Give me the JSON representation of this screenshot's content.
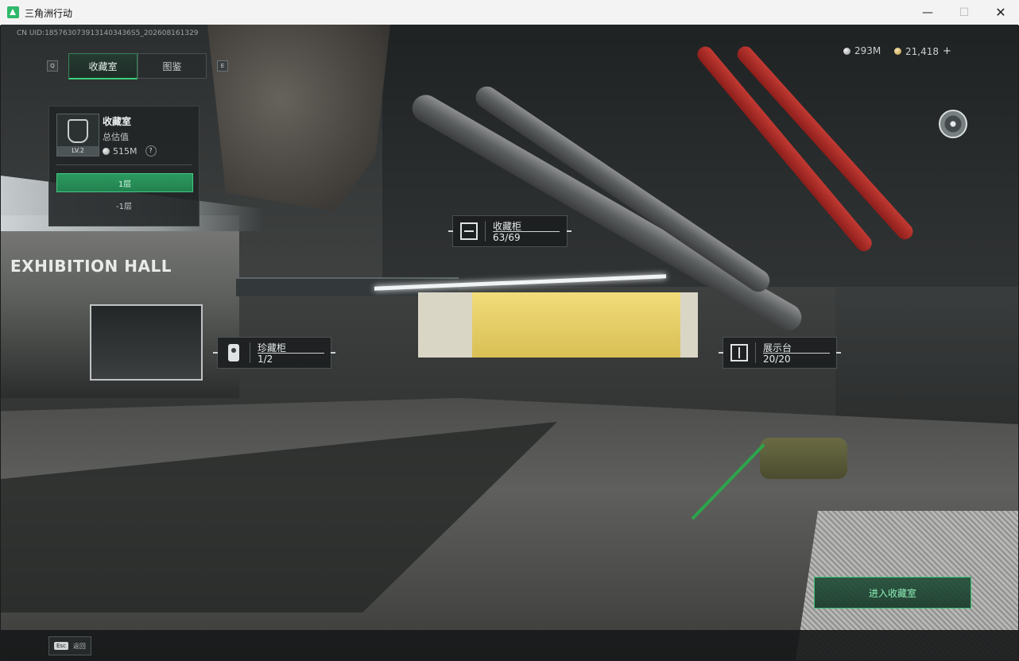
{
  "window": {
    "title": "三角洲行动",
    "minimize": "—",
    "maximize": "☐",
    "close": "✕"
  },
  "hud": {
    "uid": "CN UID:1857630739131403436S5_202608161329",
    "tabs": {
      "key_left": "Q",
      "key_right": "E",
      "items": [
        {
          "label": "收藏室",
          "active": true
        },
        {
          "label": "图鉴",
          "active": false
        }
      ]
    },
    "currency": {
      "silver": "293M",
      "gold": "21,418",
      "add": "+"
    },
    "room_card": {
      "title": "收藏室",
      "level": "LV.2",
      "value_label": "总估值",
      "value": "515M",
      "help": "?",
      "floors": [
        {
          "label": "1层",
          "active": true
        },
        {
          "label": "-1层",
          "active": false
        }
      ]
    },
    "markers": [
      {
        "label": "收藏柜",
        "count": "63/69"
      },
      {
        "label": "珍藏柜",
        "count": "1/2"
      },
      {
        "label": "展示台",
        "count": "20/20"
      }
    ],
    "enter_button": "进入收藏室",
    "esc": {
      "key": "Esc",
      "label": "返回"
    }
  },
  "scene": {
    "wall_text": "EXHIBITION HALL",
    "accent_color": "#3bd07a"
  }
}
